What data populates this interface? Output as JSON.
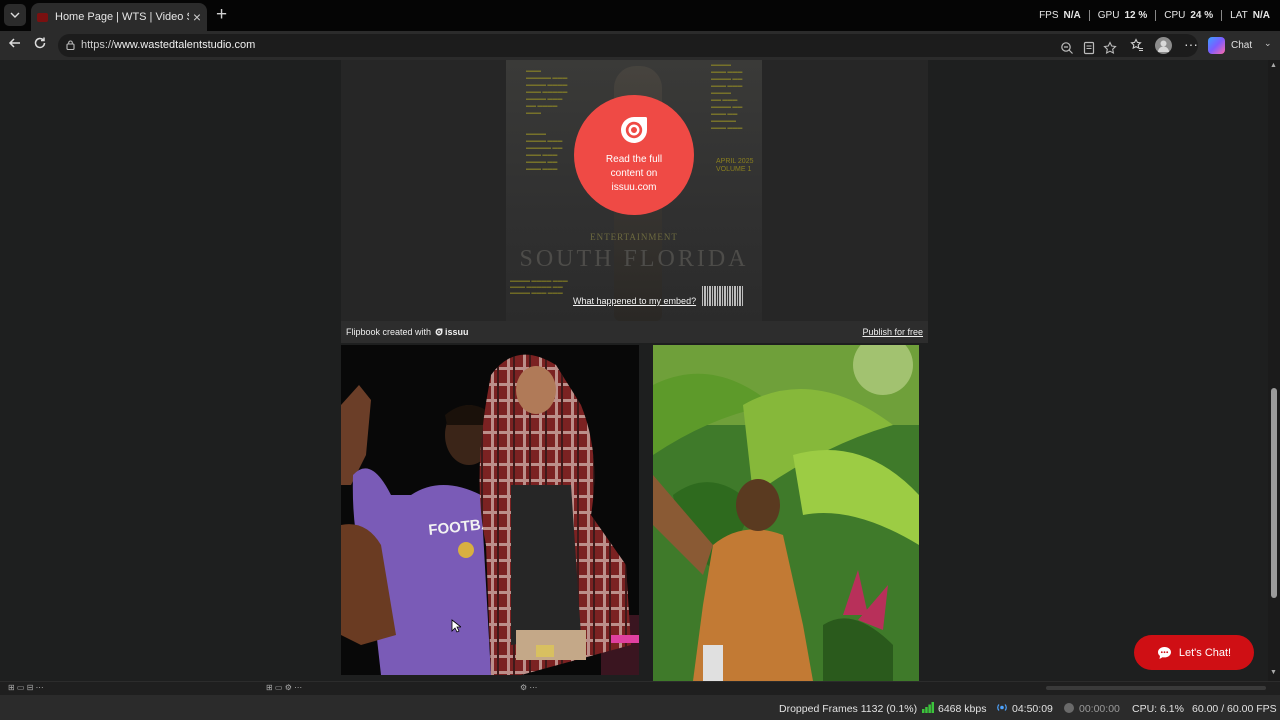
{
  "browser": {
    "tab_title": "Home Page | WTS | Video Services",
    "url_scheme": "https://",
    "url_domain": "www.wastedtalentstudio.com",
    "chat_label": "Chat"
  },
  "hud": {
    "fps_label": "FPS",
    "fps_value": "N/A",
    "gpu_label": "GPU",
    "gpu_value": "12 %",
    "cpu_label": "CPU",
    "cpu_value": "24 %",
    "lat_label": "LAT",
    "lat_value": "N/A"
  },
  "embed": {
    "overlay_text": "Read the full content on issuu.com",
    "what_happened_link": "What happened to my embed?",
    "flipbook_label": "Flipbook created with",
    "issuu_brand": "issuu",
    "publish_link": "Publish for free",
    "cover": {
      "section": "ENTERTAINMENT",
      "title": "SOUTH FLORIDA",
      "date": "APRIL 2025 VOLUME 1"
    }
  },
  "chat_widget": {
    "label": "Let's Chat!"
  },
  "status": {
    "dropped_frames": "Dropped Frames 1132 (0.1%)",
    "bitrate": "6468 kbps",
    "stream_time": "04:50:09",
    "record_time": "00:00:00",
    "cpu": "CPU: 6.1%",
    "fps": "60.00 / 60.00 FPS"
  },
  "colors": {
    "issuu_red": "#ef4a45",
    "chat_red": "#cf0f14",
    "live_blue": "#4da3ff",
    "signal_green": "#3cc43c"
  }
}
